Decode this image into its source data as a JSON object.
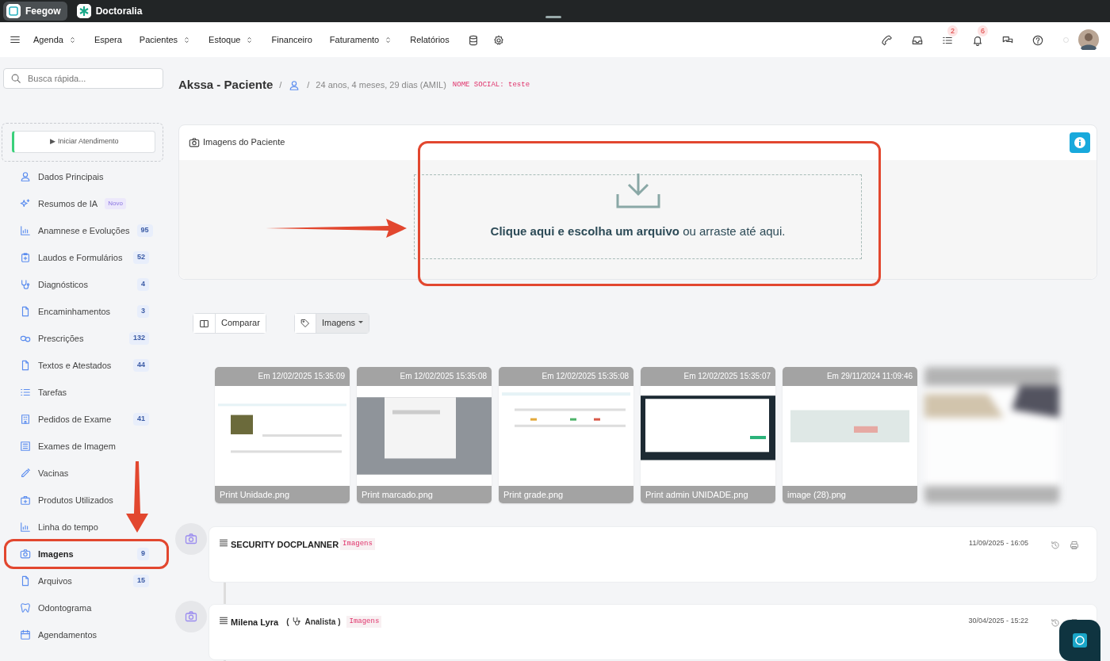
{
  "app_tabs": [
    {
      "label": "Feegow",
      "selected": true
    },
    {
      "label": "Doctoralia",
      "selected": false
    }
  ],
  "nav_items": [
    {
      "label": "Agenda",
      "dropdown": true
    },
    {
      "label": "Espera",
      "dropdown": false
    },
    {
      "label": "Pacientes",
      "dropdown": true
    },
    {
      "label": "Estoque",
      "dropdown": true
    },
    {
      "label": "Financeiro",
      "dropdown": false
    },
    {
      "label": "Faturamento",
      "dropdown": true
    },
    {
      "label": "Relatórios",
      "dropdown": false
    }
  ],
  "nav_icons": [
    {
      "kind": "database"
    },
    {
      "kind": "settings"
    }
  ],
  "header_icons": [
    {
      "kind": "phone"
    },
    {
      "kind": "inbox"
    },
    {
      "kind": "tasks",
      "badge": "2"
    },
    {
      "kind": "bell",
      "badge": "6"
    },
    {
      "kind": "chat"
    },
    {
      "kind": "help"
    }
  ],
  "search": {
    "placeholder": "Busca rápida..."
  },
  "start_button": "▶ Iniciar Atendimento",
  "sidebar": {
    "items": [
      {
        "label": "Dados Principais",
        "kind": "user",
        "selected": false
      },
      {
        "label": "Resumos de IA",
        "kind": "sparkle",
        "tag": "Novo",
        "selected": false
      },
      {
        "label": "Anamnese e Evoluções",
        "kind": "chart",
        "count": "95",
        "selected": false
      },
      {
        "label": "Laudos e Formulários",
        "kind": "clipboard",
        "count": "52",
        "selected": false
      },
      {
        "label": "Diagnósticos",
        "kind": "stethoscope",
        "count": "4",
        "selected": false
      },
      {
        "label": "Encaminhamentos",
        "kind": "file",
        "count": "3",
        "selected": false
      },
      {
        "label": "Prescrições",
        "kind": "pills",
        "count": "132",
        "selected": false
      },
      {
        "label": "Textos e Atestados",
        "kind": "file",
        "count": "44",
        "selected": false
      },
      {
        "label": "Tarefas",
        "kind": "list",
        "selected": false
      },
      {
        "label": "Pedidos de Exame",
        "kind": "building",
        "count": "41",
        "selected": false
      },
      {
        "label": "Exames de Imagem",
        "kind": "scan",
        "selected": false
      },
      {
        "label": "Vacinas",
        "kind": "syringe",
        "selected": false
      },
      {
        "label": "Produtos Utilizados",
        "kind": "box",
        "selected": false
      },
      {
        "label": "Linha do tempo",
        "kind": "chart",
        "selected": false
      },
      {
        "label": "Imagens",
        "kind": "camera",
        "count": "9",
        "selected": true
      },
      {
        "label": "Arquivos",
        "kind": "file",
        "count": "15",
        "selected": false
      },
      {
        "label": "Odontograma",
        "kind": "tooth",
        "selected": false
      },
      {
        "label": "Agendamentos",
        "kind": "calendar",
        "selected": false
      }
    ]
  },
  "patient": {
    "name": "Akssa - Paciente",
    "separators": [
      "/",
      "/"
    ],
    "age": "24 anos, 4 meses, 29 dias (AMIL)",
    "social_name": "NOME SOCIAL: teste"
  },
  "upload_card": {
    "title": "Imagens do Paciente",
    "prompt": "**Clique aqui e escolha um arquivo** ou arraste até aqui."
  },
  "toolbar": {
    "compare": "Comparar",
    "filter": "Imagens"
  },
  "gallery": [
    {
      "date": "Em 12/02/2025 15:35:09",
      "filename": "Print Unidade.png",
      "blurred": false
    },
    {
      "date": "Em 12/02/2025 15:35:08",
      "filename": "Print marcado.png",
      "blurred": false
    },
    {
      "date": "Em 12/02/2025 15:35:08",
      "filename": "Print grade.png",
      "blurred": false
    },
    {
      "date": "Em 12/02/2025 15:35:07",
      "filename": "Print admin UNIDADE.png",
      "blurred": false
    },
    {
      "date": "Em 29/11/2024 11:09:46",
      "filename": "image (28).png",
      "blurred": false
    },
    {
      "blurred": true
    }
  ],
  "timeline": [
    {
      "title": "SECURITY DOCPLANNER",
      "tag": "Imagens",
      "date": "11/09/2025 - 16:05"
    },
    {
      "title": "Milena Lyra",
      "role": [
        "(",
        "Analista )"
      ],
      "tag": "Imagens",
      "date": "30/04/2025 - 15:22"
    }
  ]
}
